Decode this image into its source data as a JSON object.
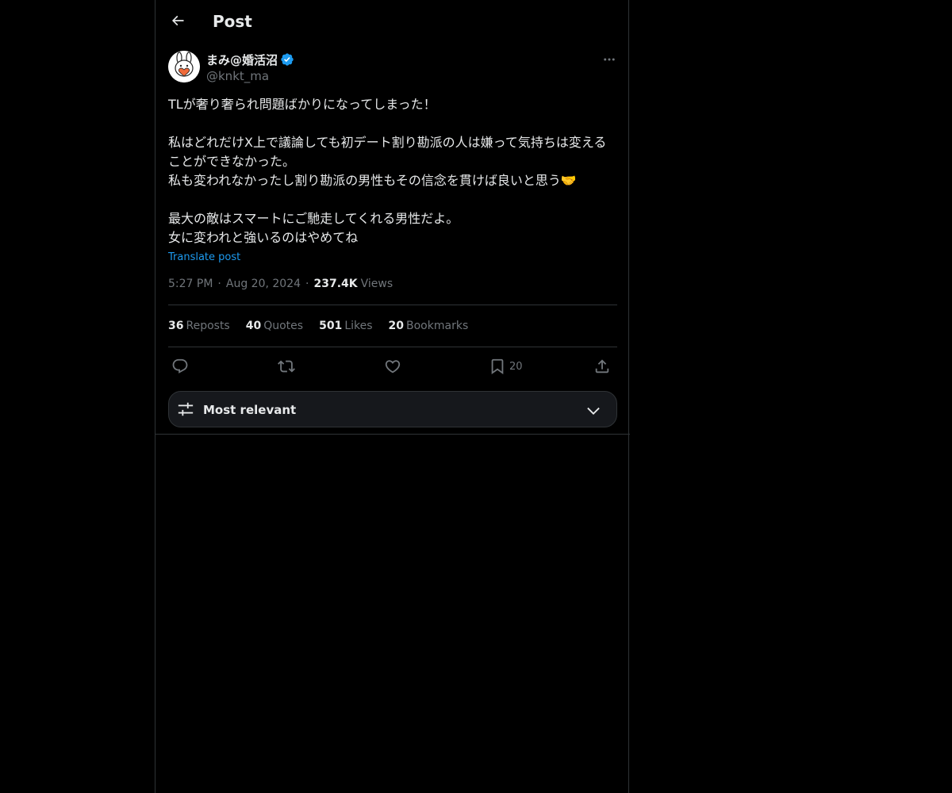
{
  "header": {
    "title": "Post",
    "back_icon": "arrow-left-icon"
  },
  "author": {
    "display_name": "まみ@婚活沼",
    "handle": "@knkt_ma",
    "verified": true,
    "avatar_icon": "cartoon-rabbit-heart-avatar"
  },
  "post": {
    "paragraphs": [
      "TLが奢り奢られ問題ばかりになってしまった！",
      "私はどれだけX上で議論しても初デート割り勘派の人は嫌って気持ちは変えることができなかった。\n私も変われなかったし割り勘派の男性もその信念を貫けば良いと思う🤝",
      "最大の敵はスマートにご馳走してくれる男性だよ。\n女に変われと強いるのはやめてね"
    ],
    "translate_label": "Translate post",
    "time": "5:27 PM",
    "date": "Aug 20, 2024",
    "views_count": "237.4K",
    "views_label": "Views"
  },
  "stats": [
    {
      "count": "36",
      "label": "Reposts"
    },
    {
      "count": "40",
      "label": "Quotes"
    },
    {
      "count": "501",
      "label": "Likes"
    },
    {
      "count": "20",
      "label": "Bookmarks"
    }
  ],
  "actions": {
    "bookmark_count": "20"
  },
  "sort": {
    "label": "Most relevant"
  },
  "colors": {
    "background": "#000000",
    "text": "#e7e9ea",
    "secondary": "#71767b",
    "accent": "#1d9bf0",
    "border": "#2f3336"
  }
}
